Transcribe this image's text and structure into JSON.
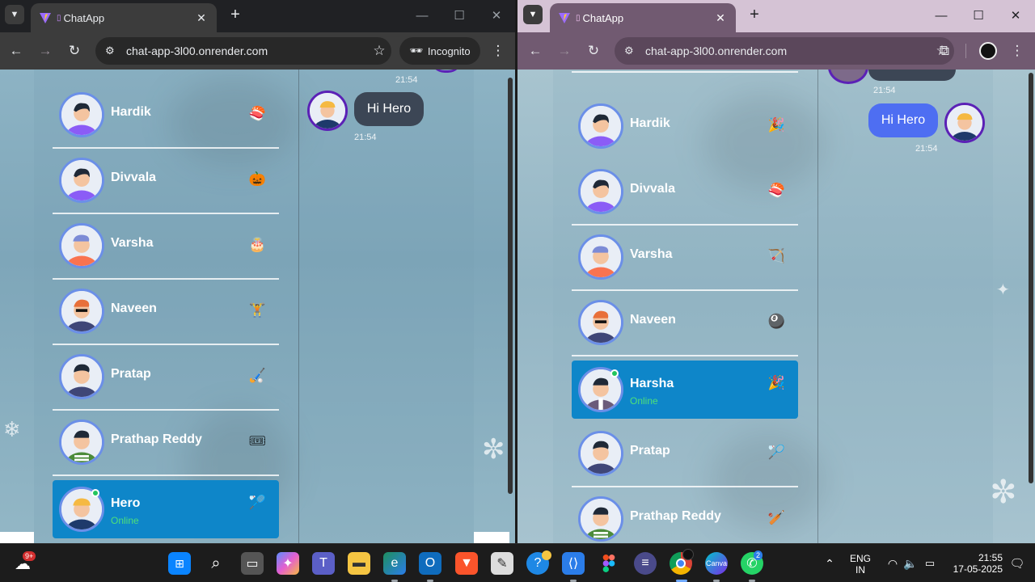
{
  "left": {
    "tab_title": "ChatApp",
    "url": "chat-app-3l00.onrender.com",
    "incognito_label": "Incognito",
    "contacts": [
      {
        "name": "Hardik",
        "emoji": "🍣"
      },
      {
        "name": "Divvala",
        "emoji": "🎃"
      },
      {
        "name": "Varsha",
        "emoji": "🎂"
      },
      {
        "name": "Naveen",
        "emoji": "🏋"
      },
      {
        "name": "Pratap",
        "emoji": "🏑"
      },
      {
        "name": "Prathap Reddy",
        "emoji": "🎟"
      },
      {
        "name": "Hero",
        "emoji": "🏸",
        "status": "Online"
      }
    ],
    "messages": [
      {
        "time": "21:54"
      },
      {
        "text": "Hi Hero",
        "time": "21:54"
      }
    ]
  },
  "right": {
    "tab_title": "ChatApp",
    "url": "chat-app-3l00.onrender.com",
    "contacts": [
      {
        "name": "Hardik",
        "emoji": "🎉"
      },
      {
        "name": "Divvala",
        "emoji": "🍣"
      },
      {
        "name": "Varsha",
        "emoji": "🏹"
      },
      {
        "name": "Naveen",
        "emoji": "🎱"
      },
      {
        "name": "Harsha",
        "emoji": "🎉",
        "status": "Online"
      },
      {
        "name": "Pratap",
        "emoji": "🏸"
      },
      {
        "name": "Prathap Reddy",
        "emoji": "🏏"
      }
    ],
    "messages": [
      {
        "time": "21:54"
      },
      {
        "text": "Hi Hero",
        "time": "21:54"
      }
    ]
  },
  "taskbar": {
    "weather_badge": "9+",
    "whatsapp_badge": "2",
    "lang_top": "ENG",
    "lang_bottom": "IN",
    "time": "21:55",
    "date": "17-05-2025"
  },
  "colors": {
    "selected_row": "#0e86c9",
    "sent_bubble": "#4e6ef2",
    "received_bubble": "#3c4655",
    "online": "#22c55e",
    "avatar_ring": "#6b8fe8"
  }
}
